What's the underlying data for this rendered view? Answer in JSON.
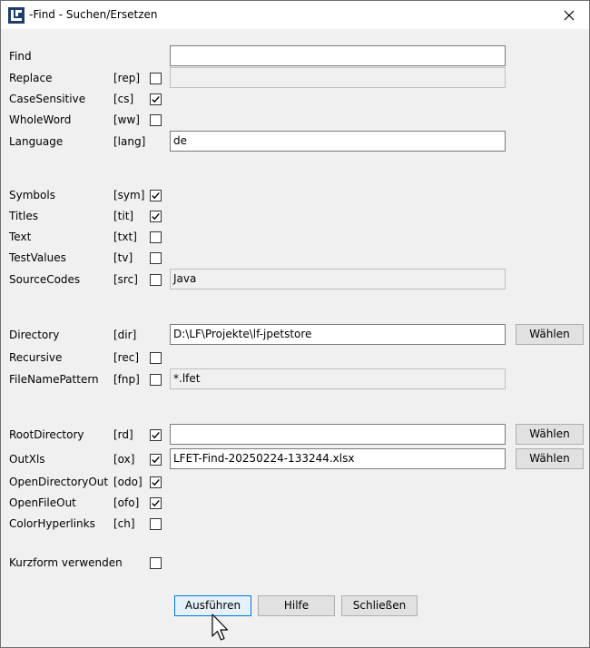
{
  "window": {
    "title": "-Find - Suchen/Ersetzen"
  },
  "rows": {
    "find": {
      "label": "Find",
      "value": ""
    },
    "replace": {
      "label": "Replace",
      "abbr": "[rep]",
      "checked": false,
      "value": ""
    },
    "case": {
      "label": "CaseSensitive",
      "abbr": "[cs]",
      "checked": true
    },
    "whole": {
      "label": "WholeWord",
      "abbr": "[ww]",
      "checked": false
    },
    "language": {
      "label": "Language",
      "abbr": "[lang]",
      "value": "de"
    },
    "symbols": {
      "label": "Symbols",
      "abbr": "[sym]",
      "checked": true
    },
    "titles": {
      "label": "Titles",
      "abbr": "[tit]",
      "checked": true
    },
    "text": {
      "label": "Text",
      "abbr": "[txt]",
      "checked": false
    },
    "testvalues": {
      "label": "TestValues",
      "abbr": "[tv]",
      "checked": false
    },
    "sourcecodes": {
      "label": "SourceCodes",
      "abbr": "[src]",
      "checked": false,
      "value": "Java"
    },
    "directory": {
      "label": "Directory",
      "abbr": "[dir]",
      "value": "D:\\LF\\Projekte\\lf-jpetstore"
    },
    "recursive": {
      "label": "Recursive",
      "abbr": "[rec]",
      "checked": false
    },
    "fnp": {
      "label": "FileNamePattern",
      "abbr": "[fnp]",
      "checked": false,
      "value": "*.lfet"
    },
    "rootdir": {
      "label": "RootDirectory",
      "abbr": "[rd]",
      "checked": true,
      "value": ""
    },
    "outxls": {
      "label": "OutXls",
      "abbr": "[ox]",
      "checked": true,
      "value": "LFET-Find-20250224-133244.xlsx"
    },
    "odo": {
      "label": "OpenDirectoryOut",
      "abbr": "[odo]",
      "checked": true
    },
    "ofo": {
      "label": "OpenFileOut",
      "abbr": "[ofo]",
      "checked": true
    },
    "ch": {
      "label": "ColorHyperlinks",
      "abbr": "[ch]",
      "checked": false
    },
    "kurz": {
      "label": "Kurzform verwenden",
      "checked": false
    }
  },
  "buttons": {
    "waehlen": "Wählen",
    "run": "Ausführen",
    "help": "Hilfe",
    "close": "Schließen"
  }
}
